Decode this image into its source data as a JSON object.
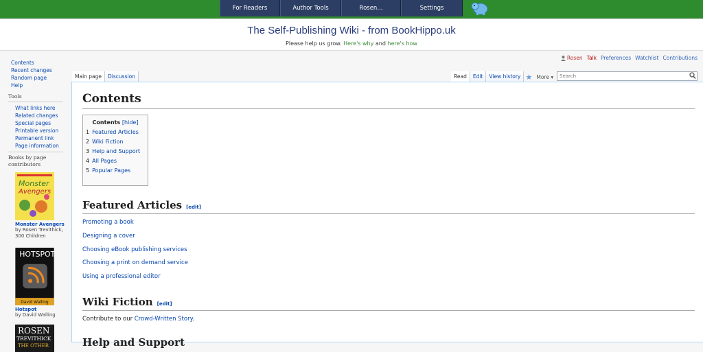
{
  "topnav": [
    "For Readers",
    "Author Tools",
    "Rosen...",
    "Settings"
  ],
  "header": {
    "title": "The Self-Publishing Wiki - from BookHippo.uk",
    "help_prefix": "Please help us grow.",
    "help_link1": "Here's why",
    "help_and": "and",
    "help_link2": "here's how"
  },
  "personal": {
    "user": "Rosen",
    "talk": "Talk",
    "preferences": "Preferences",
    "watchlist": "Watchlist",
    "contributions": "Contributions"
  },
  "sidebar": {
    "main": [
      "Contents",
      "Recent changes",
      "Random page",
      "Help"
    ],
    "tools_heading": "Tools",
    "tools": [
      "What links here",
      "Related changes",
      "Special pages",
      "Printable version",
      "Permanent link",
      "Page information"
    ],
    "books_heading": "Books by page contributors",
    "books": [
      {
        "title": "Monster Avengers",
        "by": "by Rosen Trevithick, 300 Children",
        "cover_color": "#f4e04d"
      },
      {
        "title": "Hotspot",
        "by": "by David Walling",
        "cover_color": "#222222"
      }
    ],
    "book3_title": "ROSEN TREVITHICK"
  },
  "tabs": {
    "main_page": "Main page",
    "discussion": "Discussion",
    "read": "Read",
    "edit": "Edit",
    "view_history": "View history",
    "more": "More",
    "search_placeholder": "Search"
  },
  "content": {
    "title": "Contents",
    "toc_title": "Contents",
    "toc_hide": "[hide]",
    "toc": [
      {
        "num": "1",
        "label": "Featured Articles"
      },
      {
        "num": "2",
        "label": "Wiki Fiction"
      },
      {
        "num": "3",
        "label": "Help and Support"
      },
      {
        "num": "4",
        "label": "All Pages"
      },
      {
        "num": "5",
        "label": "Popular Pages"
      }
    ],
    "featured_heading": "Featured Articles",
    "edit_label": "[edit]",
    "featured": [
      "Promoting a book",
      "Designing a cover",
      "Choosing eBook publishing services",
      "Choosing a print on demand service",
      "Using a professional editor"
    ],
    "fiction_heading": "Wiki Fiction",
    "fiction_text": "Contribute to our",
    "fiction_link": "Crowd-Written Story",
    "fiction_end": ".",
    "next_heading": "Help and Support"
  }
}
